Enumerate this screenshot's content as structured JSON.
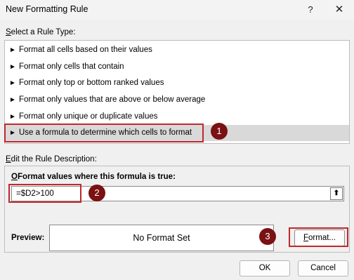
{
  "window": {
    "title": "New Formatting Rule",
    "help": "?",
    "close": "✕"
  },
  "rule_type": {
    "label_prefix": "S",
    "label_rest": "elect a Rule Type:",
    "arrow": "►",
    "items": [
      {
        "label": "Format all cells based on their values"
      },
      {
        "label": "Format only cells that contain"
      },
      {
        "label": "Format only top or bottom ranked values"
      },
      {
        "label": "Format only values that are above or below average"
      },
      {
        "label": "Format only unique or duplicate values"
      },
      {
        "label": "Use a formula to determine which cells to format"
      }
    ]
  },
  "description": {
    "label_prefix": "E",
    "label_rest": "dit the Rule Description:",
    "formula_label_prefix": "O",
    "formula_label_rest": "Format values where this formula is true:",
    "formula_value": "=$D2>100",
    "collapse_icon": "⬆",
    "preview_label": "Preview:",
    "preview_text": "No Format Set",
    "format_button_prefix": "F",
    "format_button_rest": "ormat..."
  },
  "buttons": {
    "ok": "OK",
    "cancel": "Cancel"
  },
  "annotations": {
    "badge_1": "1",
    "badge_2": "2",
    "badge_3": "3",
    "highlight_color": "#c0282c",
    "badge_color": "#7a1112"
  }
}
